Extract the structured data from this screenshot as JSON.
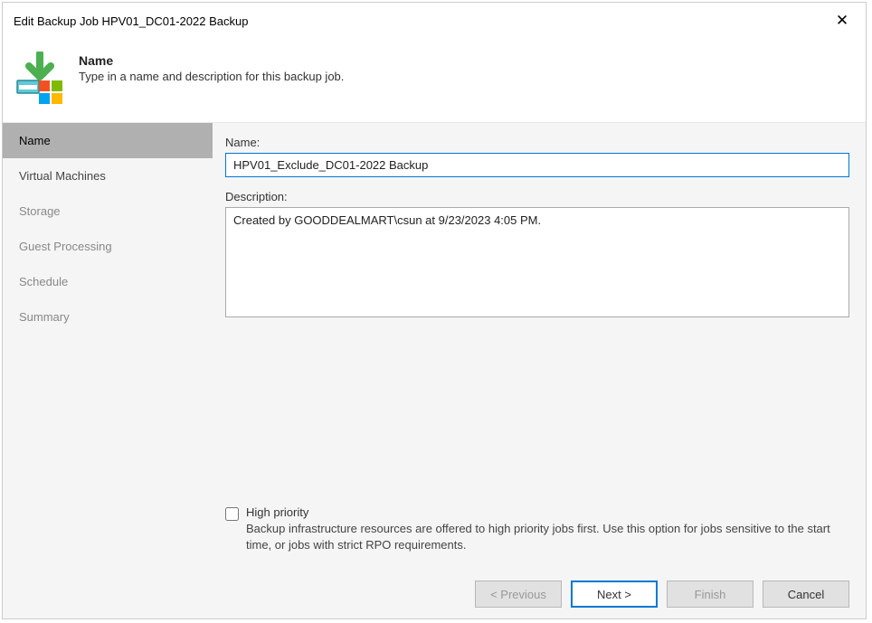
{
  "window": {
    "title": "Edit Backup Job HPV01_DC01-2022 Backup"
  },
  "header": {
    "title": "Name",
    "description": "Type in a name and description for this backup job."
  },
  "sidebar": {
    "items": [
      {
        "label": "Name",
        "active": true,
        "disabled": false
      },
      {
        "label": "Virtual Machines",
        "active": false,
        "disabled": false
      },
      {
        "label": "Storage",
        "active": false,
        "disabled": true
      },
      {
        "label": "Guest Processing",
        "active": false,
        "disabled": true
      },
      {
        "label": "Schedule",
        "active": false,
        "disabled": true
      },
      {
        "label": "Summary",
        "active": false,
        "disabled": true
      }
    ]
  },
  "form": {
    "name_label": "Name:",
    "name_value": "HPV01_Exclude_DC01-2022 Backup",
    "description_label": "Description:",
    "description_value": "Created by GOODDEALMART\\csun at 9/23/2023 4:05 PM.",
    "high_priority_label": "High priority",
    "high_priority_hint": "Backup infrastructure resources are offered to high priority jobs first. Use this option for jobs sensitive to the start time, or jobs with strict RPO requirements."
  },
  "buttons": {
    "previous": "< Previous",
    "next": "Next >",
    "finish": "Finish",
    "cancel": "Cancel"
  }
}
